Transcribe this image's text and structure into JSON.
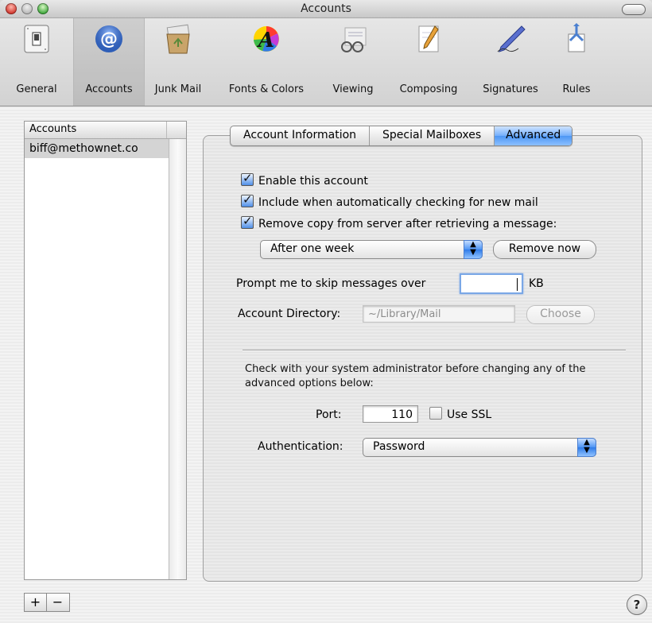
{
  "window": {
    "title": "Accounts"
  },
  "toolbar": {
    "items": [
      {
        "label": "General",
        "icon": "light-switch-icon"
      },
      {
        "label": "Accounts",
        "icon": "at-sign-icon",
        "selected": true
      },
      {
        "label": "Junk Mail",
        "icon": "recycle-bin-icon"
      },
      {
        "label": "Fonts & Colors",
        "icon": "font-color-icon"
      },
      {
        "label": "Viewing",
        "icon": "glasses-icon"
      },
      {
        "label": "Composing",
        "icon": "pencil-paper-icon"
      },
      {
        "label": "Signatures",
        "icon": "pen-icon"
      },
      {
        "label": "Rules",
        "icon": "rules-icon"
      }
    ]
  },
  "accounts": {
    "header": "Accounts",
    "items": [
      "biff@methownet.co"
    ],
    "add_label": "+",
    "remove_label": "−"
  },
  "tabs": {
    "items": [
      "Account Information",
      "Special Mailboxes",
      "Advanced"
    ],
    "active": "Advanced"
  },
  "advanced": {
    "enable_account": {
      "label": "Enable this account",
      "checked": true
    },
    "include_auto_check": {
      "label": "Include when automatically checking for new mail",
      "checked": true
    },
    "remove_copy": {
      "label": "Remove copy from server after retrieving a message:",
      "checked": true
    },
    "remove_after_value": "After one week",
    "remove_now_label": "Remove now",
    "prompt_skip_label": "Prompt me to skip messages over",
    "prompt_skip_value": "",
    "kb_label": "KB",
    "account_directory_label": "Account Directory:",
    "account_directory_value": "~/Library/Mail",
    "choose_label": "Choose",
    "note": "Check with your system administrator before changing any of the advanced options below:",
    "port_label": "Port:",
    "port_value": "110",
    "use_ssl": {
      "label": "Use SSL",
      "checked": false
    },
    "authentication_label": "Authentication:",
    "authentication_value": "Password"
  },
  "help_label": "?",
  "colors": {
    "accent": "#4d94f5",
    "selection": "#d4d4d4"
  }
}
